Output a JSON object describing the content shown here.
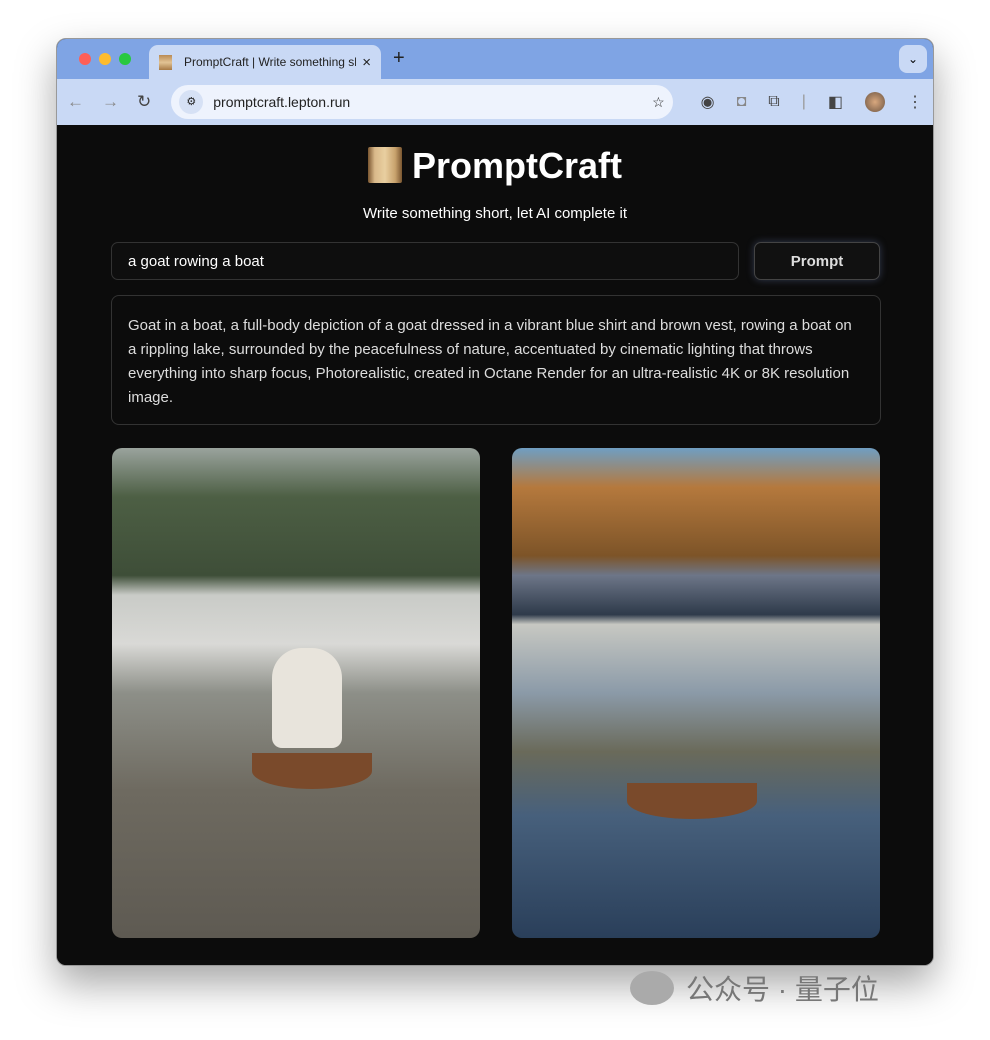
{
  "browser": {
    "tab_title": "PromptCraft | Write something short, let AI complete it",
    "url": "promptcraft.lepton.run"
  },
  "header": {
    "title": "PromptCraft",
    "subtitle": "Write something short, let AI complete it"
  },
  "prompt": {
    "value": "a goat rowing a boat",
    "button_label": "Prompt"
  },
  "output": {
    "text": "Goat in a boat, a full-body depiction of a goat dressed in a vibrant blue shirt and brown vest, rowing a boat on a rippling lake, surrounded by the peacefulness of nature, accentuated by cinematic lighting that throws everything into sharp focus, Photorealistic, created in Octane Render for an ultra-realistic 4K or 8K resolution image."
  },
  "images": [
    {
      "alt": "goat standing in a rowboat on a river"
    },
    {
      "alt": "goat in blue vest rowing a boat on an autumn lake"
    }
  ],
  "watermark": "公众号 · 量子位"
}
